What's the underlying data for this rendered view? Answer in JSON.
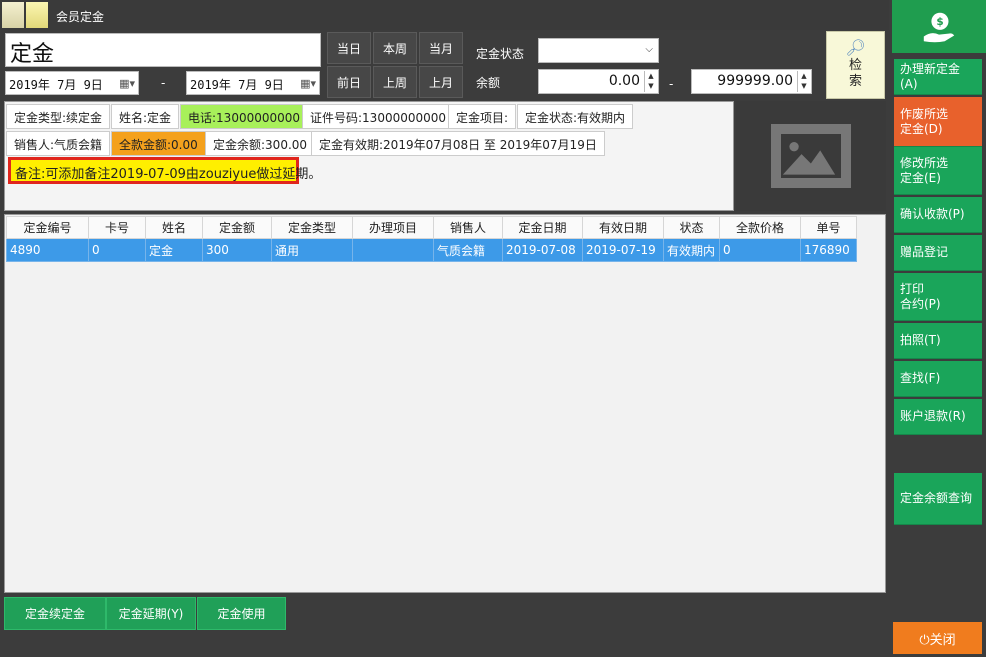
{
  "window": {
    "title": "会员定金"
  },
  "filter": {
    "name_value": "定金",
    "date_from": "2019年  7月  9日",
    "date_to": "2019年  7月  9日",
    "dash": "-",
    "quick_buttons": [
      "当日",
      "本周",
      "当月",
      "前日",
      "上周",
      "上月"
    ],
    "status_label": "定金状态",
    "status_value": "",
    "balance_label": "余额",
    "balance_min": "0.00",
    "balance_max": "999999.00",
    "search_label_1": "检",
    "search_label_2": "索"
  },
  "info": {
    "type": "定金类型:续定金",
    "name": "姓名:定金",
    "phone": "电话:13000000000",
    "id_no": "证件号码:13000000000",
    "item": "定金项目:",
    "status": "定金状态:有效期内",
    "salesperson": "销售人:气质会籍",
    "full_amount": "全款金额:0.00",
    "balance": "定金余额:300.00",
    "validity": "定金有效期:2019年07月08日 至 2019年07月19日",
    "remark": "备注:可添加备注2019-07-09由zouziyue做过延期。"
  },
  "table": {
    "headers": [
      "定金编号",
      "卡号",
      "姓名",
      "定金额",
      "定金类型",
      "办理项目",
      "销售人",
      "定金日期",
      "有效日期",
      "状态",
      "全款价格",
      "单号"
    ],
    "rows": [
      [
        "4890",
        "0",
        "定金",
        "300",
        "通用",
        "",
        "气质会籍",
        "2019-07-08",
        "2019-07-19",
        "有效期内",
        "0",
        "176890"
      ]
    ]
  },
  "bottom_buttons": [
    "定金续定金",
    "定金延期(Y)",
    "定金使用"
  ],
  "sidebar": {
    "items": [
      "办理新定金(A)",
      "作废所选\n定金(D)",
      "修改所选\n定金(E)",
      "确认收款(P)",
      "赠品登记",
      "打印\n合约(P)",
      "拍照(T)",
      "查找(F)",
      "账户退款(R)",
      "定金余额查询"
    ],
    "close": "⏻关闭"
  },
  "colors": {
    "accent_green": "#1aa55a",
    "active_orange": "#e8612c",
    "row_selected": "#3d9ae8",
    "phone_highlight": "#a8f05a",
    "amount_highlight": "#f4a11d",
    "remark_bg": "#ffef00",
    "remark_border": "#e0261d"
  },
  "icons": [
    "money-bag-hand-icon",
    "search-magnifier-icon",
    "calendar-icon",
    "image-placeholder-icon",
    "power-icon"
  ]
}
